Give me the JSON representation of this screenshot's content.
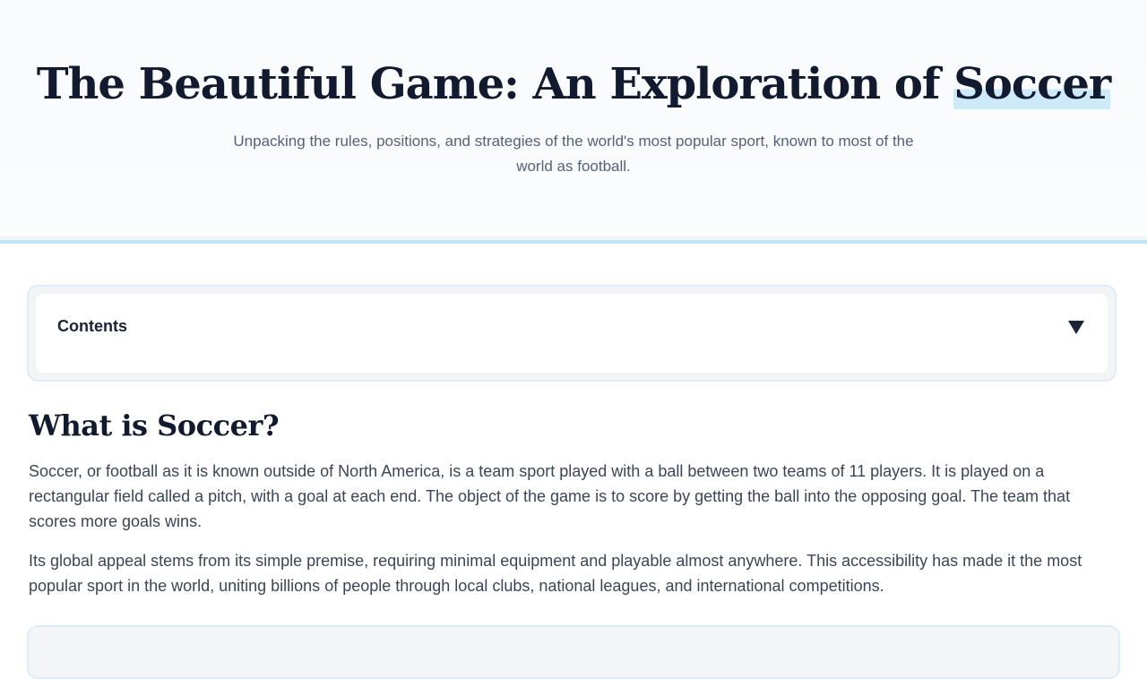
{
  "hero": {
    "title_main": "The Beautiful Game: An Exploration of ",
    "title_highlight": "Soccer",
    "subtitle": "Unpacking the rules, positions, and strategies of the world's most popular sport, known to most of the world as football."
  },
  "toc": {
    "title": "Contents",
    "toggle_icon": "caret-down-icon"
  },
  "section": {
    "title": "What is Soccer?",
    "paragraphs": [
      "Soccer, or football as it is known outside of North America, is a team sport played with a ball between two teams of 11 players. It is played on a rectangular field called a pitch, with a goal at each end. The object of the game is to score by getting the ball into the opposing goal. The team that scores more goals wins.",
      "Its global appeal stems from its simple premise, requiring minimal equipment and playable almost anywhere. This accessibility has made it the most popular sport in the world, uniting billions of people through local clubs, national leagues, and international competitions."
    ]
  },
  "colors": {
    "accent": "#bfe4f7",
    "heading": "#111a2e",
    "body_text": "#3a4658"
  }
}
